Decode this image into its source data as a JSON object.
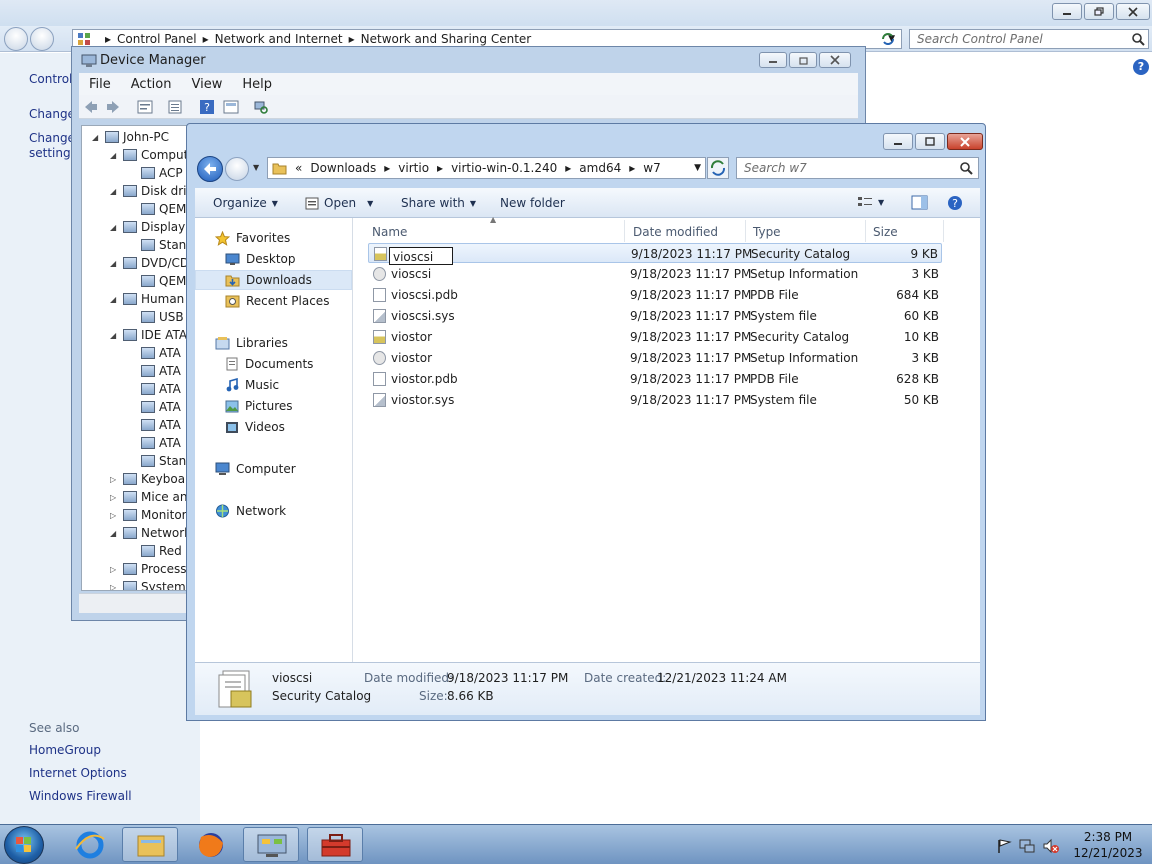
{
  "control_panel": {
    "breadcrumbs": [
      "Control Panel",
      "Network and Internet",
      "Network and Sharing Center"
    ],
    "search_placeholder": "Search Control Panel",
    "left_links": [
      "Control",
      "Change",
      "Change",
      "settings"
    ],
    "see_also": "See also",
    "see_also_links": [
      "HomeGroup",
      "Internet Options",
      "Windows Firewall"
    ]
  },
  "device_manager": {
    "title": "Device Manager",
    "menu": [
      "File",
      "Action",
      "View",
      "Help"
    ],
    "tree": [
      {
        "label": "John-PC",
        "level": 0,
        "expander": "◢"
      },
      {
        "label": "Comput",
        "level": 1,
        "expander": "◢"
      },
      {
        "label": "ACP",
        "level": 2,
        "expander": ""
      },
      {
        "label": "Disk driv",
        "level": 1,
        "expander": "◢"
      },
      {
        "label": "QEM",
        "level": 2,
        "expander": ""
      },
      {
        "label": "Display a",
        "level": 1,
        "expander": "◢"
      },
      {
        "label": "Stan",
        "level": 2,
        "expander": ""
      },
      {
        "label": "DVD/CD",
        "level": 1,
        "expander": "◢"
      },
      {
        "label": "QEM",
        "level": 2,
        "expander": ""
      },
      {
        "label": "Human",
        "level": 1,
        "expander": "◢"
      },
      {
        "label": "USB",
        "level": 2,
        "expander": ""
      },
      {
        "label": "IDE ATA",
        "level": 1,
        "expander": "◢"
      },
      {
        "label": "ATA",
        "level": 2,
        "expander": ""
      },
      {
        "label": "ATA",
        "level": 2,
        "expander": ""
      },
      {
        "label": "ATA",
        "level": 2,
        "expander": ""
      },
      {
        "label": "ATA",
        "level": 2,
        "expander": ""
      },
      {
        "label": "ATA",
        "level": 2,
        "expander": ""
      },
      {
        "label": "ATA",
        "level": 2,
        "expander": ""
      },
      {
        "label": "Stan",
        "level": 2,
        "expander": ""
      },
      {
        "label": "Keyboar",
        "level": 1,
        "expander": "▷"
      },
      {
        "label": "Mice an",
        "level": 1,
        "expander": "▷"
      },
      {
        "label": "Monitor",
        "level": 1,
        "expander": "▷"
      },
      {
        "label": "Network",
        "level": 1,
        "expander": "◢"
      },
      {
        "label": "Red",
        "level": 2,
        "expander": ""
      },
      {
        "label": "Processo",
        "level": 1,
        "expander": "▷"
      },
      {
        "label": "System",
        "level": 1,
        "expander": "▷"
      }
    ]
  },
  "explorer": {
    "breadcrumbs": [
      "«",
      "Downloads",
      "virtio",
      "virtio-win-0.1.240",
      "amd64",
      "w7"
    ],
    "search_placeholder": "Search w7",
    "commands": {
      "organize": "Organize",
      "open": "Open",
      "share_with": "Share with",
      "new_folder": "New folder"
    },
    "nav_pane": {
      "favorites": "Favorites",
      "favorites_items": [
        "Desktop",
        "Downloads",
        "Recent Places"
      ],
      "libraries": "Libraries",
      "libraries_items": [
        "Documents",
        "Music",
        "Pictures",
        "Videos"
      ],
      "computer": "Computer",
      "network": "Network"
    },
    "columns": {
      "name": "Name",
      "date": "Date modified",
      "type": "Type",
      "size": "Size"
    },
    "files": [
      {
        "name": "vioscsi",
        "date": "9/18/2023 11:17 PM",
        "type": "Security Catalog",
        "size": "9 KB",
        "icon": "catalog-icon",
        "selected": true,
        "renaming": true
      },
      {
        "name": "vioscsi",
        "date": "9/18/2023 11:17 PM",
        "type": "Setup Information",
        "size": "3 KB",
        "icon": "setup-info-icon"
      },
      {
        "name": "vioscsi.pdb",
        "date": "9/18/2023 11:17 PM",
        "type": "PDB File",
        "size": "684 KB",
        "icon": "file-icon"
      },
      {
        "name": "vioscsi.sys",
        "date": "9/18/2023 11:17 PM",
        "type": "System file",
        "size": "60 KB",
        "icon": "system-file-icon"
      },
      {
        "name": "viostor",
        "date": "9/18/2023 11:17 PM",
        "type": "Security Catalog",
        "size": "10 KB",
        "icon": "catalog-icon"
      },
      {
        "name": "viostor",
        "date": "9/18/2023 11:17 PM",
        "type": "Setup Information",
        "size": "3 KB",
        "icon": "setup-info-icon"
      },
      {
        "name": "viostor.pdb",
        "date": "9/18/2023 11:17 PM",
        "type": "PDB File",
        "size": "628 KB",
        "icon": "file-icon"
      },
      {
        "name": "viostor.sys",
        "date": "9/18/2023 11:17 PM",
        "type": "System file",
        "size": "50 KB",
        "icon": "system-file-icon"
      }
    ],
    "details": {
      "name": "vioscsi",
      "type": "Security Catalog",
      "date_modified_label": "Date modified:",
      "date_modified": "9/18/2023 11:17 PM",
      "date_created_label": "Date created:",
      "date_created": "12/21/2023 11:24 AM",
      "size_label": "Size:",
      "size": "8.66 KB"
    }
  },
  "taskbar": {
    "time": "2:38 PM",
    "date": "12/21/2023"
  },
  "colors": {
    "link": "#1e3287",
    "selection": "#dbe8f8",
    "taskbar": "#6f94c1"
  }
}
